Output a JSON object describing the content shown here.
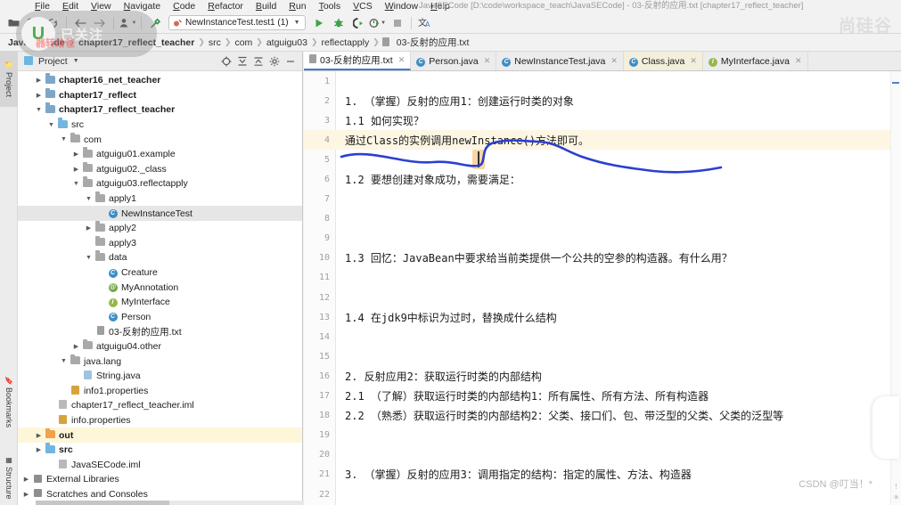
{
  "window": {
    "title": "JavaSECode [D:\\code\\workspace_teach\\JavaSECode] - 03-反射的应用.txt [chapter17_reflect_teacher]"
  },
  "menubar": {
    "items": [
      "File",
      "Edit",
      "View",
      "Navigate",
      "Code",
      "Refactor",
      "Build",
      "Run",
      "Tools",
      "VCS",
      "Window",
      "Help"
    ]
  },
  "toolbar": {
    "open_icon": "open-folder-icon",
    "save_icon": "save-all-icon",
    "sync_icon": "sync-icon",
    "back_icon": "back-arrow-icon",
    "forward_icon": "forward-arrow-icon",
    "avatar_icon": "user-avatar-icon",
    "build_icon": "hammer-build-icon",
    "run_icon": "run-icon",
    "debug_icon": "debug-icon",
    "coverage_icon": "run-with-coverage-icon",
    "profile_icon": "profile-icon",
    "stop_icon": "stop-icon",
    "translate_icon": "translate-icon",
    "run_config": "NewInstanceTest.test1 (1)"
  },
  "breadcrumb": {
    "items": [
      {
        "label": "JavaSECode",
        "bold": true
      },
      {
        "label": "chapter17_reflect_teacher",
        "bold": true
      },
      {
        "label": "src",
        "bold": false
      },
      {
        "label": "com",
        "bold": false
      },
      {
        "label": "atguigu03",
        "bold": false
      },
      {
        "label": "reflectapply",
        "bold": false
      },
      {
        "label": "03-反射的应用.txt",
        "bold": false
      }
    ]
  },
  "vertical_tabs": [
    {
      "label": "Project",
      "selected": true
    },
    {
      "label": "Bookmarks",
      "selected": false
    },
    {
      "label": "Structure",
      "selected": false
    }
  ],
  "project_panel": {
    "title": "Project",
    "icons": [
      "locate-target-icon",
      "expand-all-icon",
      "collapse-all-icon",
      "settings-gear-icon",
      "minimize-icon"
    ],
    "tree": [
      {
        "indent": 1,
        "arrow": "right",
        "icon": "fmod",
        "label": "chapter16_net_teacher",
        "bold": true,
        "state": ""
      },
      {
        "indent": 1,
        "arrow": "right",
        "icon": "fmod",
        "label": "chapter17_reflect",
        "bold": true,
        "state": ""
      },
      {
        "indent": 1,
        "arrow": "down",
        "icon": "fmod",
        "label": "chapter17_reflect_teacher",
        "bold": true,
        "state": ""
      },
      {
        "indent": 2,
        "arrow": "down",
        "icon": "fsrc",
        "label": "src",
        "bold": false,
        "state": ""
      },
      {
        "indent": 3,
        "arrow": "down",
        "icon": "fpkg",
        "label": "com",
        "bold": false,
        "state": ""
      },
      {
        "indent": 4,
        "arrow": "right",
        "icon": "fpkg",
        "label": "atguigu01.example",
        "bold": false,
        "state": ""
      },
      {
        "indent": 4,
        "arrow": "right",
        "icon": "fpkg",
        "label": "atguigu02._class",
        "bold": false,
        "state": ""
      },
      {
        "indent": 4,
        "arrow": "down",
        "icon": "fpkg",
        "label": "atguigu03.reflectapply",
        "bold": false,
        "state": ""
      },
      {
        "indent": 5,
        "arrow": "down",
        "icon": "fpkg",
        "label": "apply1",
        "bold": false,
        "state": ""
      },
      {
        "indent": 6,
        "arrow": "none",
        "icon": "bC",
        "label": "NewInstanceTest",
        "bold": false,
        "state": "sel"
      },
      {
        "indent": 5,
        "arrow": "right",
        "icon": "fpkg",
        "label": "apply2",
        "bold": false,
        "state": ""
      },
      {
        "indent": 5,
        "arrow": "none",
        "icon": "fpkg",
        "label": "apply3",
        "bold": false,
        "state": ""
      },
      {
        "indent": 5,
        "arrow": "down",
        "icon": "fpkg",
        "label": "data",
        "bold": false,
        "state": ""
      },
      {
        "indent": 6,
        "arrow": "none",
        "icon": "bC",
        "label": "Creature",
        "bold": false,
        "state": ""
      },
      {
        "indent": 6,
        "arrow": "none",
        "icon": "bA",
        "label": "MyAnnotation",
        "bold": false,
        "state": ""
      },
      {
        "indent": 6,
        "arrow": "none",
        "icon": "bI",
        "label": "MyInterface",
        "bold": false,
        "state": ""
      },
      {
        "indent": 6,
        "arrow": "none",
        "icon": "bC",
        "label": "Person",
        "bold": false,
        "state": ""
      },
      {
        "indent": 5,
        "arrow": "none",
        "icon": "ftxt",
        "label": "03-反射的应用.txt",
        "bold": false,
        "state": ""
      },
      {
        "indent": 4,
        "arrow": "right",
        "icon": "fpkg",
        "label": "atguigu04.other",
        "bold": false,
        "state": ""
      },
      {
        "indent": 3,
        "arrow": "down",
        "icon": "fpkg",
        "label": "java.lang",
        "bold": false,
        "state": ""
      },
      {
        "indent": 4,
        "arrow": "none",
        "icon": "fjava",
        "label": "String.java",
        "bold": false,
        "state": ""
      },
      {
        "indent": 3,
        "arrow": "none",
        "icon": "fprop",
        "label": "info1.properties",
        "bold": false,
        "state": ""
      },
      {
        "indent": 2,
        "arrow": "none",
        "icon": "fiml",
        "label": "chapter17_reflect_teacher.iml",
        "bold": false,
        "state": ""
      },
      {
        "indent": 2,
        "arrow": "none",
        "icon": "fprop",
        "label": "info.properties",
        "bold": false,
        "state": ""
      },
      {
        "indent": 1,
        "arrow": "right",
        "icon": "fout",
        "label": "out",
        "bold": true,
        "state": "hl"
      },
      {
        "indent": 1,
        "arrow": "right",
        "icon": "fsrc",
        "label": "src",
        "bold": true,
        "state": ""
      },
      {
        "indent": 2,
        "arrow": "none",
        "icon": "fiml",
        "label": "JavaSECode.iml",
        "bold": false,
        "state": ""
      },
      {
        "indent": 0,
        "arrow": "right",
        "icon": "flib",
        "label": "External Libraries",
        "bold": false,
        "state": ""
      },
      {
        "indent": 0,
        "arrow": "right",
        "icon": "flib",
        "label": "Scratches and Consoles",
        "bold": false,
        "state": ""
      }
    ]
  },
  "editor_tabs": [
    {
      "label": "03-反射的应用.txt",
      "icon": "text-file-icon",
      "state": "active"
    },
    {
      "label": "Person.java",
      "icon": "class-icon",
      "state": ""
    },
    {
      "label": "NewInstanceTest.java",
      "icon": "class-run-icon",
      "state": ""
    },
    {
      "label": "Class.java",
      "icon": "class-icon",
      "state": "tan"
    },
    {
      "label": "MyInterface.java",
      "icon": "interface-icon",
      "state": ""
    }
  ],
  "editor": {
    "lines": [
      {
        "n": "1",
        "text": "",
        "cur": false
      },
      {
        "n": "2",
        "text": "1. （掌握）反射的应用1：创建运行时类的对象",
        "cur": false
      },
      {
        "n": "3",
        "text": "1.1 如何实现？",
        "cur": false
      },
      {
        "n": "4",
        "text": "通过Class的实例调用newInstance()方法即可。",
        "cur": true
      },
      {
        "n": "5",
        "text": "",
        "cur": false
      },
      {
        "n": "6",
        "text": "1.2 要想创建对象成功，需要满足：",
        "cur": false
      },
      {
        "n": "7",
        "text": "",
        "cur": false
      },
      {
        "n": "8",
        "text": "",
        "cur": false
      },
      {
        "n": "9",
        "text": "",
        "cur": false
      },
      {
        "n": "10",
        "text": "1.3 回忆：JavaBean中要求给当前类提供一个公共的空参的构造器。有什么用？",
        "cur": false
      },
      {
        "n": "11",
        "text": "",
        "cur": false
      },
      {
        "n": "12",
        "text": "",
        "cur": false
      },
      {
        "n": "13",
        "text": "1.4 在jdk9中标识为过时，替换成什么结构",
        "cur": false
      },
      {
        "n": "14",
        "text": "",
        "cur": false
      },
      {
        "n": "15",
        "text": "",
        "cur": false
      },
      {
        "n": "16",
        "text": "2. 反射应用2：获取运行时类的内部结构",
        "cur": false
      },
      {
        "n": "17",
        "text": "2.1 （了解）获取运行时类的内部结构1：所有属性、所有方法、所有构造器",
        "cur": false
      },
      {
        "n": "18",
        "text": "2.2 （熟悉）获取运行时类的内部结构2：父类、接口们、包、带泛型的父类、父类的泛型等",
        "cur": false
      },
      {
        "n": "19",
        "text": "",
        "cur": false
      },
      {
        "n": "20",
        "text": "",
        "cur": false
      },
      {
        "n": "21",
        "text": "3. （掌握）反射的应用3：调用指定的结构：指定的属性、方法、构造器",
        "cur": false
      },
      {
        "n": "22",
        "text": "",
        "cur": false
      }
    ]
  },
  "overlays": {
    "follow_label": "已关注",
    "follow_logo_letter": "U",
    "sub_watermark": "器转给爸",
    "corner_watermark": "尚硅谷",
    "csdn_watermark": "CSDN @叮当！*"
  },
  "colors": {
    "accent": "#3a7fd5",
    "ink": "#2b3fd0",
    "current_line": "#fdf6e3",
    "selection": "#e6e6e6",
    "highlight": "#fdf6d8"
  }
}
